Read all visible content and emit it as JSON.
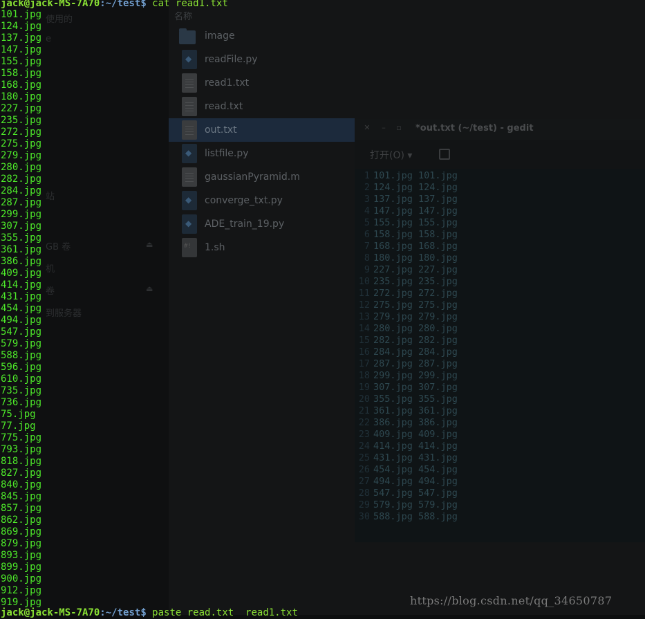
{
  "terminal": {
    "prompt_top": {
      "user_host": "jack@jack-MS-7A70",
      "path": ":~/test",
      "symbol": "$",
      "command": " cat read1.txt"
    },
    "output_lines": [
      "101.jpg",
      "124.jpg",
      "137.jpg",
      "147.jpg",
      "155.jpg",
      "158.jpg",
      "168.jpg",
      "180.jpg",
      "227.jpg",
      "235.jpg",
      "272.jpg",
      "275.jpg",
      "279.jpg",
      "280.jpg",
      "282.jpg",
      "284.jpg",
      "287.jpg",
      "299.jpg",
      "307.jpg",
      "355.jpg",
      "361.jpg",
      "386.jpg",
      "409.jpg",
      "414.jpg",
      "431.jpg",
      "454.jpg",
      "494.jpg",
      "547.jpg",
      "579.jpg",
      "588.jpg",
      "596.jpg",
      "610.jpg",
      "735.jpg",
      "736.jpg",
      "75.jpg",
      "77.jpg",
      "775.jpg",
      "793.jpg",
      "818.jpg",
      "827.jpg",
      "840.jpg",
      "845.jpg",
      "857.jpg",
      "862.jpg",
      "869.jpg",
      "879.jpg",
      "893.jpg",
      "899.jpg",
      "900.jpg",
      "912.jpg",
      "919.jpg"
    ],
    "prompt_bottom": {
      "user_host": "jack@jack-MS-7A70",
      "path": ":~/test",
      "symbol": "$",
      "command": " paste read.txt  read1.txt"
    }
  },
  "sidebar_ghost": {
    "items": [
      "使用的",
      "e",
      "站",
      "GB 卷",
      "机",
      "卷",
      "到服务器"
    ],
    "eject_symbol": "⏏"
  },
  "file_manager": {
    "column_header": "名称",
    "files": [
      {
        "name": "image",
        "icon": "folder-icon"
      },
      {
        "name": "readFile.py",
        "icon": "python-file-icon"
      },
      {
        "name": "read1.txt",
        "icon": "text-file-icon"
      },
      {
        "name": "read.txt",
        "icon": "text-file-icon"
      },
      {
        "name": "out.txt",
        "icon": "text-file-icon",
        "selected": true
      },
      {
        "name": "listfile.py",
        "icon": "python-file-icon"
      },
      {
        "name": "gaussianPyramid.m",
        "icon": "text-file-icon"
      },
      {
        "name": "converge_txt.py",
        "icon": "python-file-icon"
      },
      {
        "name": "ADE_train_19.py",
        "icon": "python-file-icon"
      },
      {
        "name": "1.sh",
        "icon": "shell-script-icon"
      }
    ]
  },
  "gedit": {
    "title": "*out.txt (~/test) - gedit",
    "open_button": "打开(O) ▾",
    "close_symbol": "✕",
    "minimize_symbol": "–",
    "maximize_symbol": "▫",
    "lines": [
      {
        "n": "1",
        "text": "101.jpg 101.jpg"
      },
      {
        "n": "2",
        "text": "124.jpg 124.jpg"
      },
      {
        "n": "3",
        "text": "137.jpg 137.jpg"
      },
      {
        "n": "4",
        "text": "147.jpg 147.jpg"
      },
      {
        "n": "5",
        "text": "155.jpg 155.jpg"
      },
      {
        "n": "6",
        "text": "158.jpg 158.jpg"
      },
      {
        "n": "7",
        "text": "168.jpg 168.jpg"
      },
      {
        "n": "8",
        "text": "180.jpg 180.jpg"
      },
      {
        "n": "9",
        "text": "227.jpg 227.jpg"
      },
      {
        "n": "10",
        "text": "235.jpg 235.jpg"
      },
      {
        "n": "11",
        "text": "272.jpg 272.jpg"
      },
      {
        "n": "12",
        "text": "275.jpg 275.jpg"
      },
      {
        "n": "13",
        "text": "279.jpg 279.jpg"
      },
      {
        "n": "14",
        "text": "280.jpg 280.jpg"
      },
      {
        "n": "15",
        "text": "282.jpg 282.jpg"
      },
      {
        "n": "16",
        "text": "284.jpg 284.jpg"
      },
      {
        "n": "17",
        "text": "287.jpg 287.jpg"
      },
      {
        "n": "18",
        "text": "299.jpg 299.jpg"
      },
      {
        "n": "19",
        "text": "307.jpg 307.jpg"
      },
      {
        "n": "20",
        "text": "355.jpg 355.jpg"
      },
      {
        "n": "21",
        "text": "361.jpg 361.jpg"
      },
      {
        "n": "22",
        "text": "386.jpg 386.jpg"
      },
      {
        "n": "23",
        "text": "409.jpg 409.jpg"
      },
      {
        "n": "24",
        "text": "414.jpg 414.jpg"
      },
      {
        "n": "25",
        "text": "431.jpg 431.jpg"
      },
      {
        "n": "26",
        "text": "454.jpg 454.jpg"
      },
      {
        "n": "27",
        "text": "494.jpg 494.jpg"
      },
      {
        "n": "28",
        "text": "547.jpg 547.jpg"
      },
      {
        "n": "29",
        "text": "579.jpg 579.jpg"
      },
      {
        "n": "30",
        "text": "588.jpg 588.jpg"
      }
    ]
  },
  "watermark": "https://blog.csdn.net/qq_34650787"
}
